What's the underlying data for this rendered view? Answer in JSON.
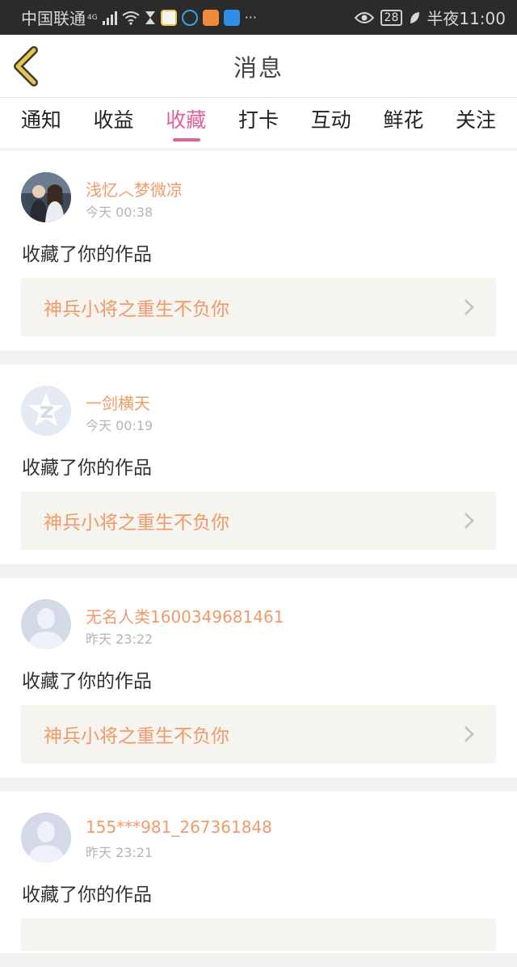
{
  "status_bar": {
    "carrier": "中国联通",
    "network": "4G",
    "more": "···",
    "battery": "28",
    "time": "半夜11:00"
  },
  "header": {
    "title": "消息"
  },
  "tabs": [
    {
      "label": "通知",
      "active": false
    },
    {
      "label": "收益",
      "active": false
    },
    {
      "label": "收藏",
      "active": true
    },
    {
      "label": "打卡",
      "active": false
    },
    {
      "label": "互动",
      "active": false
    },
    {
      "label": "鲜花",
      "active": false
    },
    {
      "label": "关注",
      "active": false
    }
  ],
  "messages": [
    {
      "username": "浅忆︿梦微凉",
      "time": "今天 00:38",
      "action": "收藏了你的作品",
      "work": "神兵小将之重生不负你",
      "avatar": "photo"
    },
    {
      "username": "一剑横天",
      "time": "今天 00:19",
      "action": "收藏了你的作品",
      "work": "神兵小将之重生不负你",
      "avatar": "qq-star"
    },
    {
      "username": "无名人类1600349681461",
      "time": "昨天 23:22",
      "action": "收藏了你的作品",
      "work": "神兵小将之重生不负你",
      "avatar": "default-person"
    },
    {
      "username": "155***981_267361848",
      "time": "昨天 23:21",
      "action": "收藏了你的作品",
      "work": "",
      "avatar": "default-person"
    }
  ],
  "colors": {
    "accent": "#e0609a",
    "name_orange": "#f09a6a",
    "back_icon": "#e8c74a"
  }
}
